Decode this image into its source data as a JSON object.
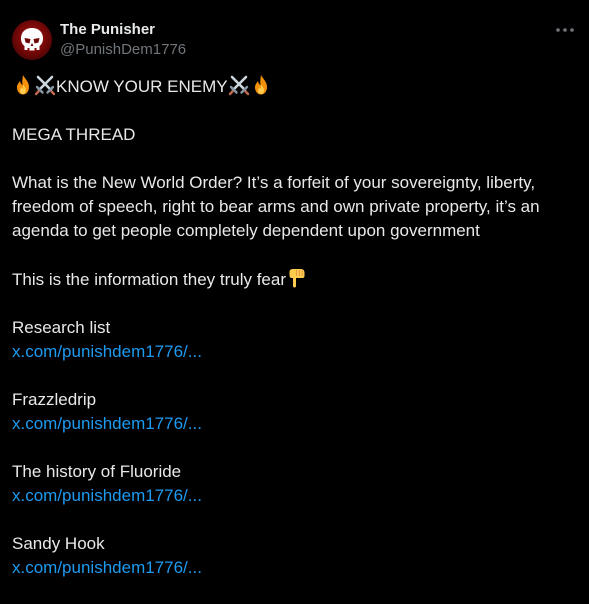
{
  "author": {
    "display_name": "The Punisher",
    "handle": "@PunishDem1776"
  },
  "colors": {
    "background": "#000000",
    "text": "#e7e9ea",
    "secondary": "#71767b",
    "link": "#1d9bf0",
    "avatar": "#b31313"
  },
  "icons": {
    "menu": "more-horizontal-icon",
    "fire": "fire-emoji",
    "swords": "crossed-swords-emoji",
    "pointing": "backhand-pointing-down-emoji"
  },
  "tweet": {
    "headline": "KNOW YOUR ENEMY",
    "subheadline": "MEGA THREAD",
    "intro_line1": "What is the New World Order? It’s a forfeit of your sovereignty, liberty,",
    "intro_line2": "freedom of speech, right to bear arms and own private property, it’s an",
    "intro_line3": "agenda to get people completely dependent upon government",
    "fear_text": "This is the information they truly fear",
    "sections": [
      {
        "title": "Research list",
        "link": "x.com/punishdem1776/..."
      },
      {
        "title": "Frazzledrip",
        "link": "x.com/punishdem1776/..."
      },
      {
        "title": "The history of Fluoride",
        "link": "x.com/punishdem1776/..."
      },
      {
        "title": "Sandy Hook",
        "link": "x.com/punishdem1776/..."
      }
    ]
  }
}
